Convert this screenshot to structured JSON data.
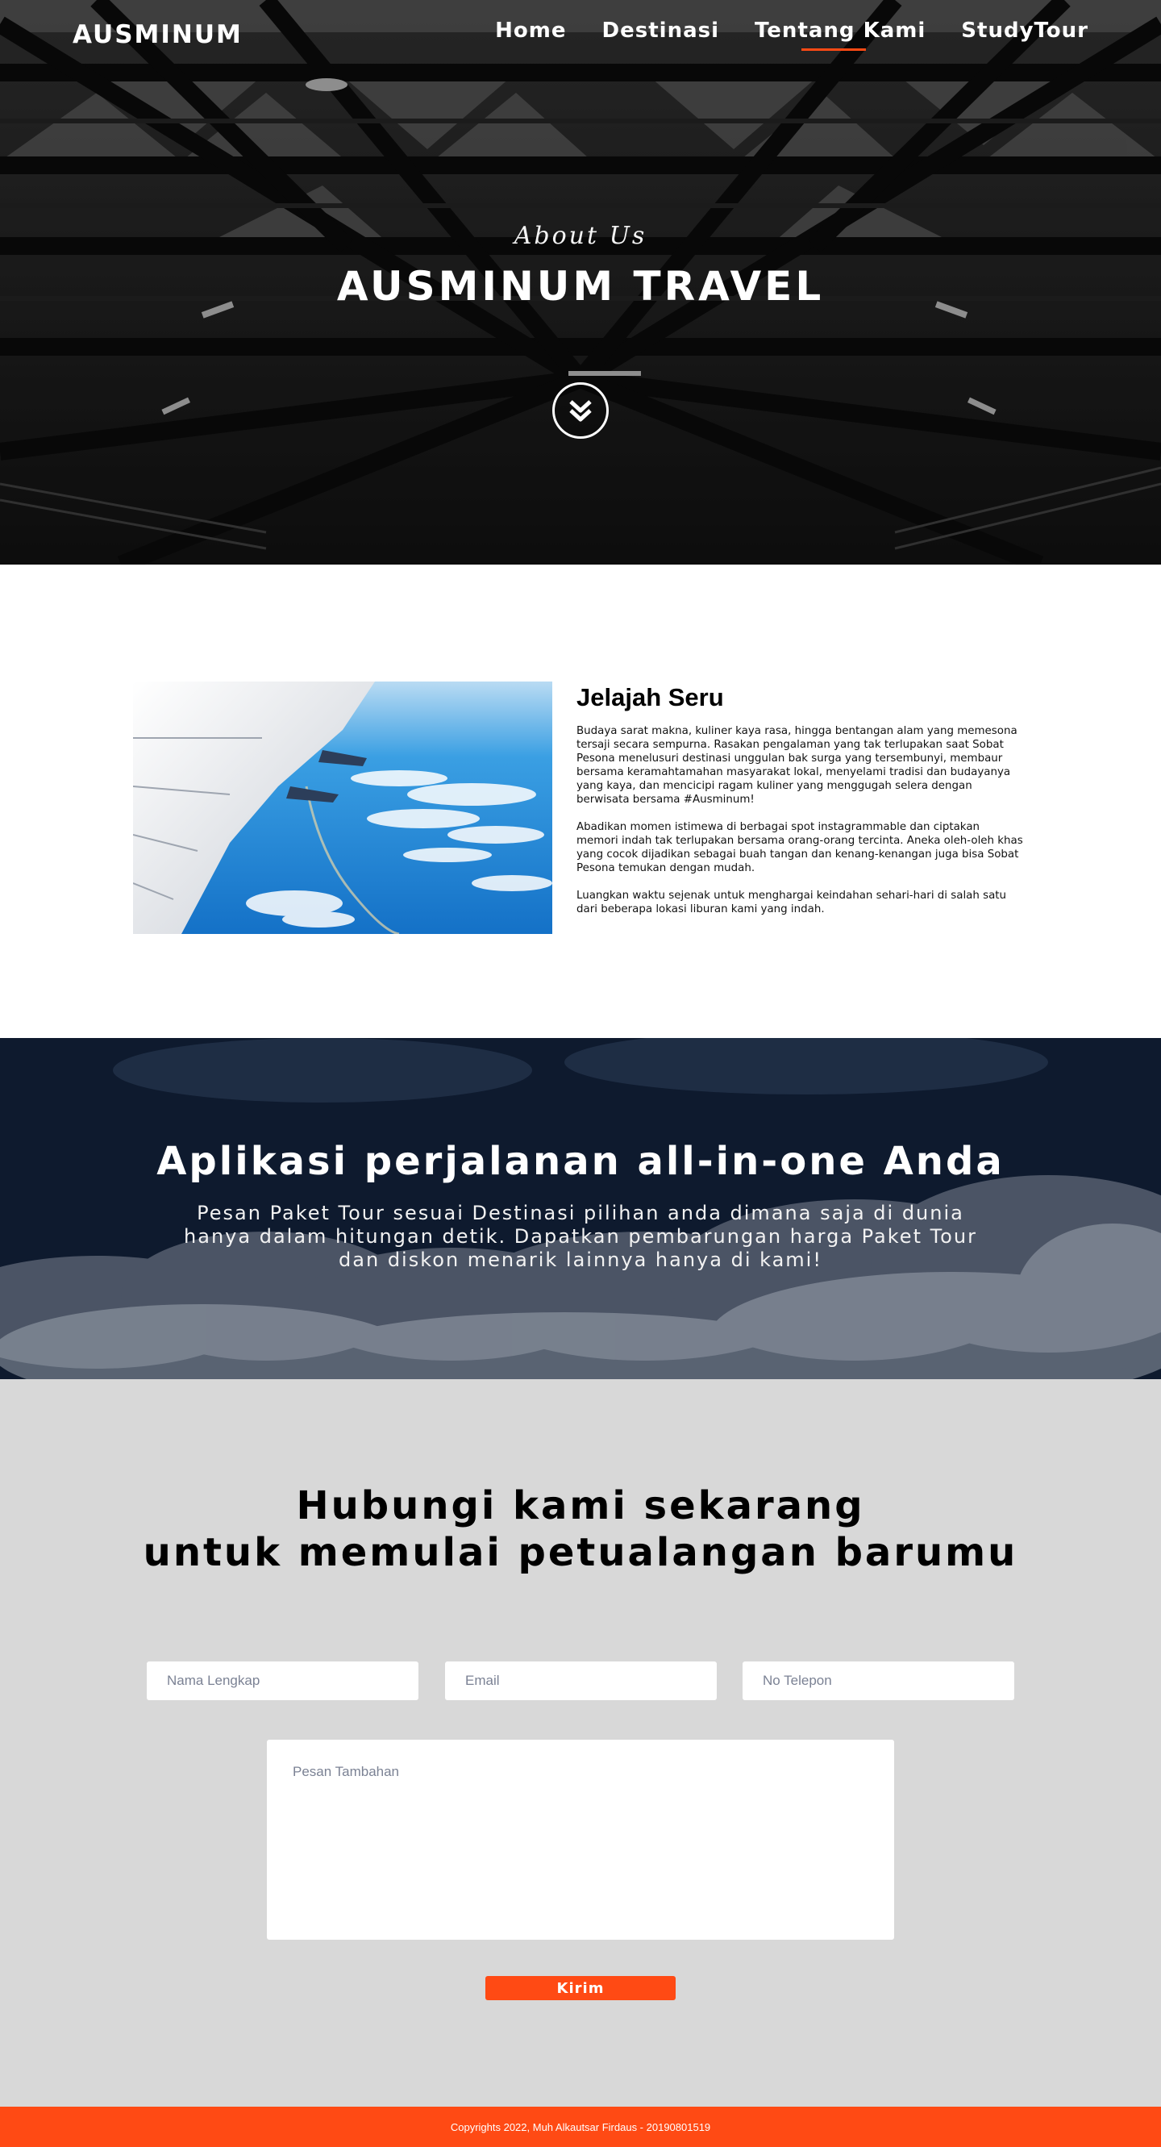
{
  "colors": {
    "accent": "#ff4a14",
    "contact_background": "#d8d8d8",
    "banner_background": "#0b1628",
    "text_dark": "#000000",
    "white": "#ffffff"
  },
  "nav": {
    "brand": "AUSMINUM",
    "items": [
      {
        "label": "Home"
      },
      {
        "label": "Destinasi"
      },
      {
        "label": "Tentang Kami",
        "active": true
      },
      {
        "label": "StudyTour"
      }
    ]
  },
  "hero": {
    "eyebrow": "About Us",
    "title": "AUSMINUM TRAVEL",
    "scroll_icon": "chevron-double-down-icon"
  },
  "about": {
    "image": "airplane-wing-photo",
    "title": "Jelajah Seru",
    "paragraphs": [
      "Budaya sarat makna, kuliner kaya rasa, hingga bentangan alam yang memesona tersaji secara sempurna. Rasakan pengalaman yang tak terlupakan saat Sobat Pesona menelusuri destinasi unggulan bak surga yang tersembunyi, membaur bersama keramahtamahan masyarakat lokal, menyelami tradisi dan budayanya yang kaya, dan mencicipi ragam kuliner yang menggugah selera dengan berwisata bersama #Ausminum!",
      "Abadikan momen istimewa di berbagai spot instagrammable dan ciptakan memori indah tak terlupakan bersama orang-orang tercinta. Aneka oleh-oleh khas yang cocok dijadikan sebagai buah tangan dan kenang-kenangan juga bisa Sobat Pesona temukan dengan mudah.",
      "Luangkan waktu sejenak untuk menghargai keindahan sehari-hari di salah satu dari beberapa lokasi liburan kami yang indah."
    ]
  },
  "banner": {
    "title": "Aplikasi perjalanan all-in-one Anda",
    "description": "Pesan Paket Tour sesuai Destinasi pilihan anda dimana saja di dunia hanya dalam hitungan detik. Dapatkan pembarungan harga Paket Tour dan diskon menarik lainnya hanya di kami!"
  },
  "contact": {
    "title_line1": "Hubungi kami sekarang",
    "title_line2": "untuk memulai petualangan barumu",
    "name_placeholder": "Nama Lengkap",
    "email_placeholder": "Email",
    "phone_placeholder": "No Telepon",
    "message_placeholder": "Pesan Tambahan",
    "submit_label": "Kirim"
  },
  "footer": {
    "copyright": "Copyrights 2022, Muh Alkautsar Firdaus - 20190801519"
  }
}
